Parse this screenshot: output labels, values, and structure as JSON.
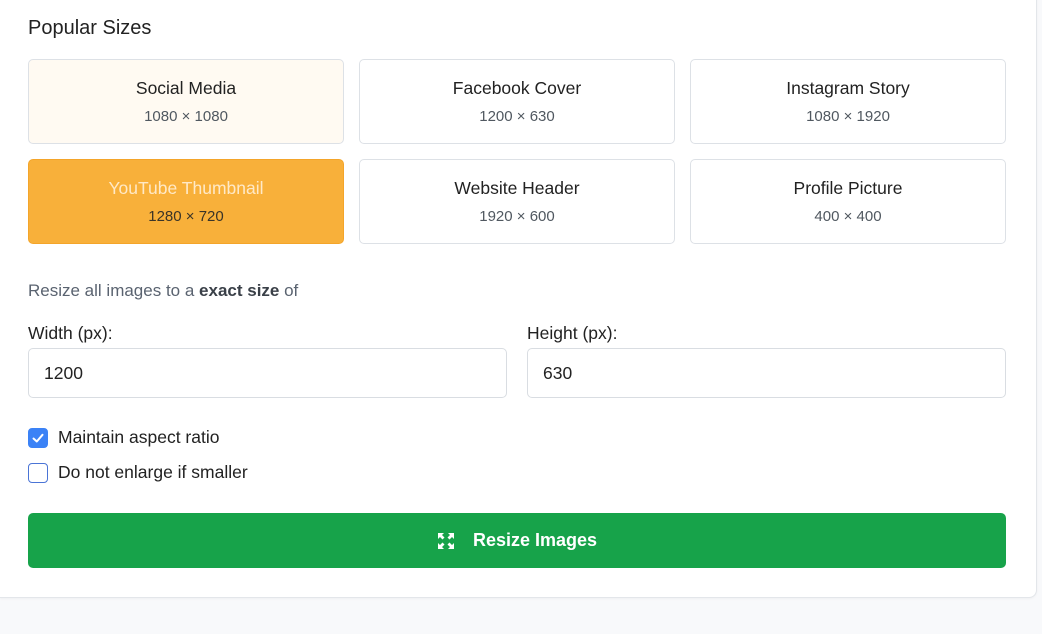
{
  "popular_sizes": {
    "title": "Popular Sizes",
    "presets": [
      {
        "name": "Social Media",
        "dims": "1080 × 1080",
        "state": "hovered"
      },
      {
        "name": "Facebook Cover",
        "dims": "1200 × 630",
        "state": "normal"
      },
      {
        "name": "Instagram Story",
        "dims": "1080 × 1920",
        "state": "normal"
      },
      {
        "name": "YouTube Thumbnail",
        "dims": "1280 × 720",
        "state": "selected"
      },
      {
        "name": "Website Header",
        "dims": "1920 × 600",
        "state": "normal"
      },
      {
        "name": "Profile Picture",
        "dims": "400 × 400",
        "state": "normal"
      }
    ]
  },
  "instruction": {
    "prefix": "Resize all images to a ",
    "emphasis": "exact size",
    "suffix": " of"
  },
  "width_field": {
    "label": "Width (px):",
    "value": "1200"
  },
  "height_field": {
    "label": "Height (px):",
    "value": "630"
  },
  "options": {
    "maintain_aspect": {
      "label": "Maintain aspect ratio",
      "checked": true
    },
    "no_enlarge": {
      "label": "Do not enlarge if smaller",
      "checked": false
    }
  },
  "resize_button": {
    "label": "Resize Images",
    "icon": "expand-arrows-icon"
  },
  "colors": {
    "selected_preset": "#f8b03a",
    "primary_button": "#17a34a",
    "checkbox_accent": "#3b82f6"
  }
}
